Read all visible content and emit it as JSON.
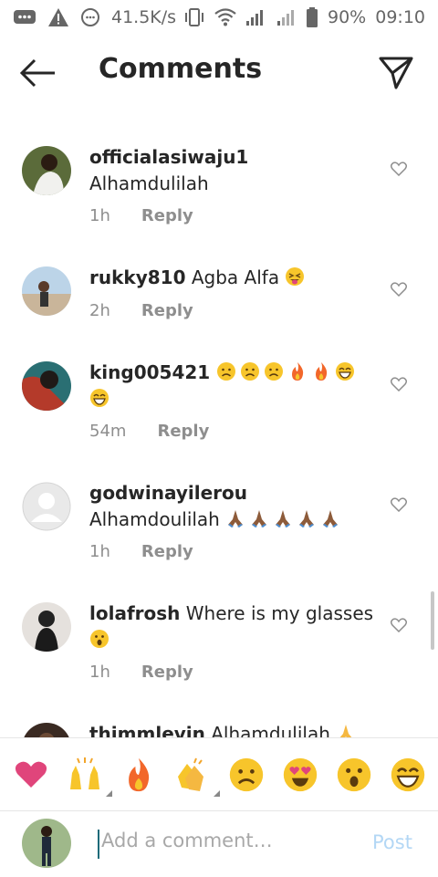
{
  "status_bar": {
    "network_speed": "41.5K/s",
    "battery": "90%",
    "time": "09:10"
  },
  "header": {
    "title": "Comments"
  },
  "comments": [
    {
      "username": "officialasiwaju1",
      "text": "Alhamdulilah",
      "time": "1h",
      "reply_label": "Reply",
      "emojis": []
    },
    {
      "username": "rukky810",
      "text": "Agba Alfa",
      "time": "2h",
      "reply_label": "Reply",
      "emojis": [
        "tongue-face"
      ]
    },
    {
      "username": "king005421",
      "text": "",
      "time": "54m",
      "reply_label": "Reply",
      "emojis": [
        "sad-face",
        "sad-face",
        "sad-face",
        "fire",
        "fire",
        "grin-face",
        "grin-face"
      ]
    },
    {
      "username": "godwinayilerou",
      "text": "Alhamdoulilah",
      "time": "1h",
      "reply_label": "Reply",
      "emojis": [
        "pray",
        "pray",
        "pray",
        "pray",
        "pray"
      ]
    },
    {
      "username": "lolafrosh",
      "text": "Where is my glasses",
      "time": "1h",
      "reply_label": "Reply",
      "emojis": [
        "surprised-face"
      ]
    },
    {
      "username": "thimmlevin",
      "text": "Alhamdulilah",
      "time": "",
      "reply_label": "",
      "emojis": [
        "pray"
      ]
    }
  ],
  "emoji_bar": [
    "heart",
    "raised-hands",
    "fire",
    "clapping-hands",
    "sad-face",
    "heart-eyes",
    "surprised-face",
    "grin-face"
  ],
  "composer": {
    "placeholder": "Add a comment…",
    "post_label": "Post"
  },
  "colors": {
    "link_disabled": "#b3d7f5",
    "muted": "#8e8e8e",
    "heart": "#e0457b"
  }
}
